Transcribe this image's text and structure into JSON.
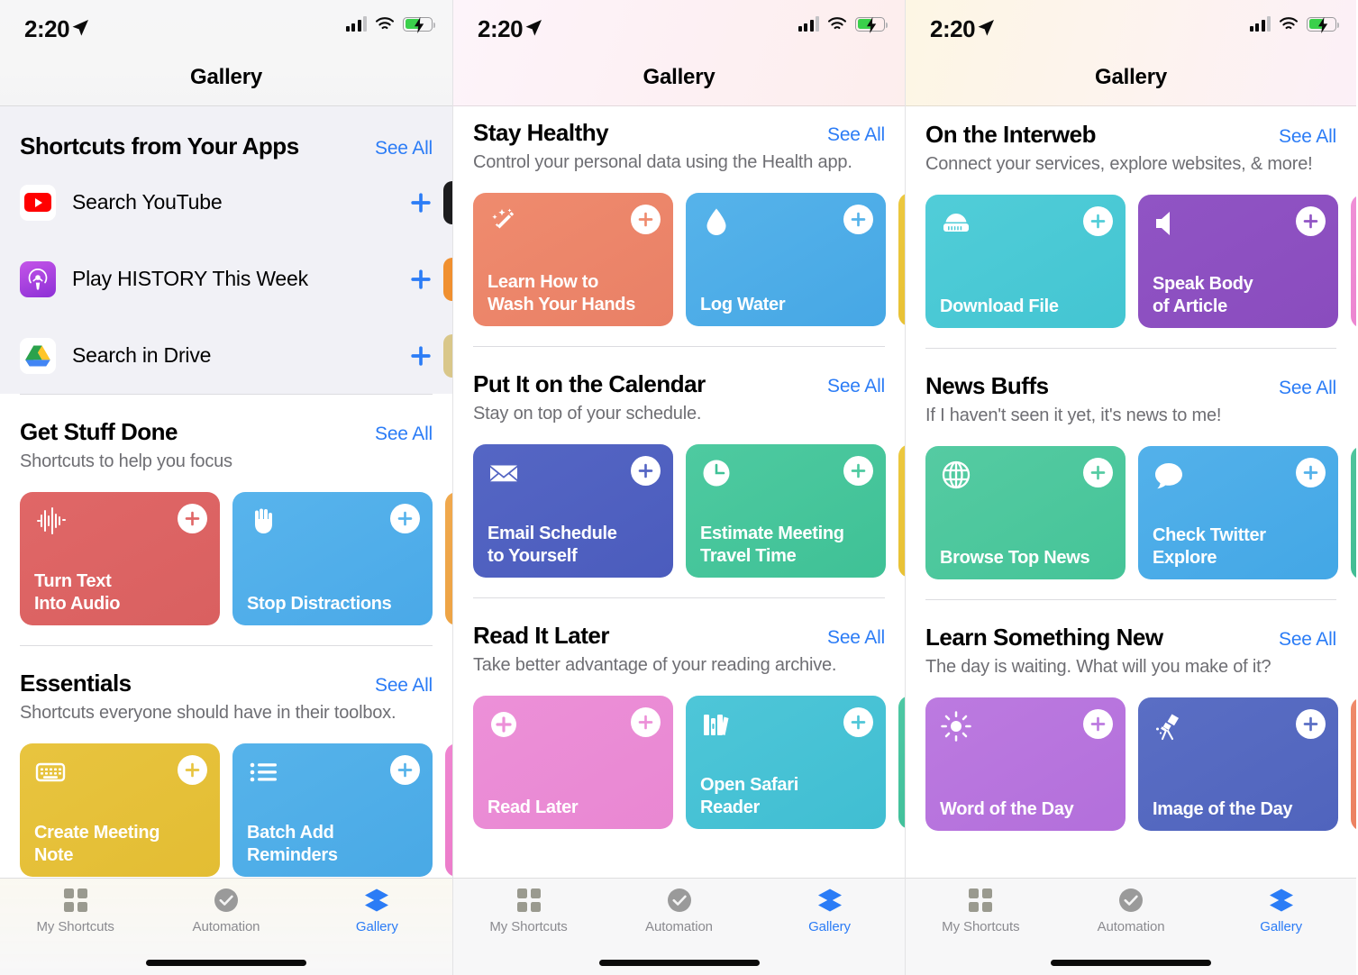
{
  "status_bar": {
    "time": "2:20",
    "location_icon": "location-arrow-icon",
    "signal_icon": "cellular-signal-icon",
    "wifi_icon": "wifi-icon",
    "battery_icon": "battery-charging-icon"
  },
  "nav": {
    "title": "Gallery"
  },
  "tab_bar": {
    "tabs": [
      {
        "label": "My Shortcuts",
        "icon": "grid-squares-icon",
        "active": false
      },
      {
        "label": "Automation",
        "icon": "checkmark-circle-icon",
        "active": false
      },
      {
        "label": "Gallery",
        "icon": "stacked-layers-icon",
        "active": true
      }
    ]
  },
  "colors": {
    "accent_blue": "#2b7cf6",
    "group_bg": "#f1f1f6",
    "subtitle_gray": "#6e6e73"
  },
  "panels": [
    {
      "id": "panel-1",
      "apps_section": {
        "title": "Shortcuts from Your Apps",
        "see_all": "See All",
        "items": [
          {
            "name": "Search YouTube",
            "icon": "youtube-icon",
            "add": "plus-icon",
            "peek_color": "#1c1c1e"
          },
          {
            "name": "Play HISTORY This Week",
            "icon": "podcasts-icon",
            "add": "plus-icon",
            "peek_color": "#f09030"
          },
          {
            "name": "Search in Drive",
            "icon": "google-drive-icon",
            "add": "plus-icon",
            "peek_color": "#d9c78a"
          }
        ]
      },
      "sections": [
        {
          "title": "Get Stuff Done",
          "see_all": "See All",
          "subtitle": "Shortcuts to help you focus",
          "cards": [
            {
              "title": "Turn Text\nInto Audio",
              "icon": "waveform-icon",
              "color1": "#e06767",
              "color2": "#d96060"
            },
            {
              "title": "Stop Distractions",
              "icon": "raised-hand-icon",
              "color1": "#58b4ec",
              "color2": "#4aa9e8"
            },
            {
              "peek": true,
              "color1": "#f0a94e",
              "color2": "#eda344"
            }
          ]
        },
        {
          "title": "Essentials",
          "see_all": "See All",
          "subtitle": "Shortcuts everyone should have in their toolbox.",
          "cards": [
            {
              "title": "Create Meeting\nNote",
              "icon": "keyboard-icon",
              "color1": "#e8c43f",
              "color2": "#e3bd33"
            },
            {
              "title": "Batch Add\nReminders",
              "icon": "bullet-list-icon",
              "color1": "#56b3ea",
              "color2": "#49a9e6"
            },
            {
              "peek": true,
              "color1": "#ef85d0",
              "color2": "#ec7cca"
            }
          ]
        }
      ]
    },
    {
      "id": "panel-2",
      "sections": [
        {
          "title": "Stay Healthy",
          "see_all": "See All",
          "subtitle": "Control your personal data using the Health app.",
          "cards": [
            {
              "title": "Learn How to\nWash Your Hands",
              "icon": "magic-wand-sparkles-icon",
              "color1": "#ef8b6e",
              "color2": "#e98066"
            },
            {
              "title": "Log Water",
              "icon": "water-drop-icon",
              "color1": "#56b3ea",
              "color2": "#46a7e5"
            },
            {
              "peek": true,
              "color1": "#ecc83f",
              "color2": "#e8c134"
            }
          ]
        },
        {
          "title": "Put It on the Calendar",
          "see_all": "See All",
          "subtitle": "Stay on top of your schedule.",
          "cards": [
            {
              "title": "Email Schedule\nto Yourself",
              "icon": "envelope-icon",
              "color1": "#5566c4",
              "color2": "#4b5cbd"
            },
            {
              "title": "Estimate Meeting\nTravel Time",
              "icon": "clock-icon",
              "color1": "#4ecaa0",
              "color2": "#3fc196"
            },
            {
              "peek": true,
              "color1": "#ecc83f",
              "color2": "#e8c134"
            }
          ]
        },
        {
          "title": "Read It Later",
          "see_all": "See All",
          "subtitle": "Take better advantage of your reading archive.",
          "cards": [
            {
              "title": "Read Later",
              "icon": "plus-circle-icon",
              "color1": "#ec90d8",
              "color2": "#e987d2"
            },
            {
              "title": "Open Safari\nReader",
              "icon": "books-icon",
              "color1": "#4ec6d8",
              "color2": "#40bed2"
            },
            {
              "peek": true,
              "color1": "#4ec8a4",
              "color2": "#41c09a"
            }
          ]
        }
      ]
    },
    {
      "id": "panel-3",
      "sections": [
        {
          "title": "On the Interweb",
          "see_all": "See All",
          "subtitle": "Connect your services, explore websites, & more!",
          "cards": [
            {
              "title": "Download File",
              "icon": "download-disk-icon",
              "color1": "#51cdd8",
              "color2": "#43c5d2"
            },
            {
              "title": "Speak Body\nof Article",
              "icon": "speaker-icon",
              "color1": "#9054c4",
              "color2": "#8a4cbe"
            },
            {
              "peek": true,
              "color1": "#ef8fd6",
              "color2": "#ec85d0"
            }
          ]
        },
        {
          "title": "News Buffs",
          "see_all": "See All",
          "subtitle": "If I haven't seen it yet, it's news to me!",
          "cards": [
            {
              "title": "Browse Top News",
              "icon": "globe-icon",
              "color1": "#55cba2",
              "color2": "#45c498"
            },
            {
              "title": "Check Twitter\nExplore",
              "icon": "speech-bubble-icon",
              "color1": "#53b1ea",
              "color2": "#43a7e6"
            },
            {
              "peek": true,
              "color1": "#4ec49c",
              "color2": "#41bc93"
            }
          ]
        },
        {
          "title": "Learn Something New",
          "see_all": "See All",
          "subtitle": "The day is waiting. What will you make of it?",
          "cards": [
            {
              "title": "Word of the Day",
              "icon": "sun-icon",
              "color1": "#bc7ae0",
              "color2": "#b36fdb"
            },
            {
              "title": "Image of the Day",
              "icon": "telescope-icon",
              "color1": "#5a6ec4",
              "color2": "#5064bd"
            },
            {
              "peek": true,
              "color1": "#ef8a6a",
              "color2": "#eb8060"
            }
          ]
        }
      ]
    }
  ]
}
